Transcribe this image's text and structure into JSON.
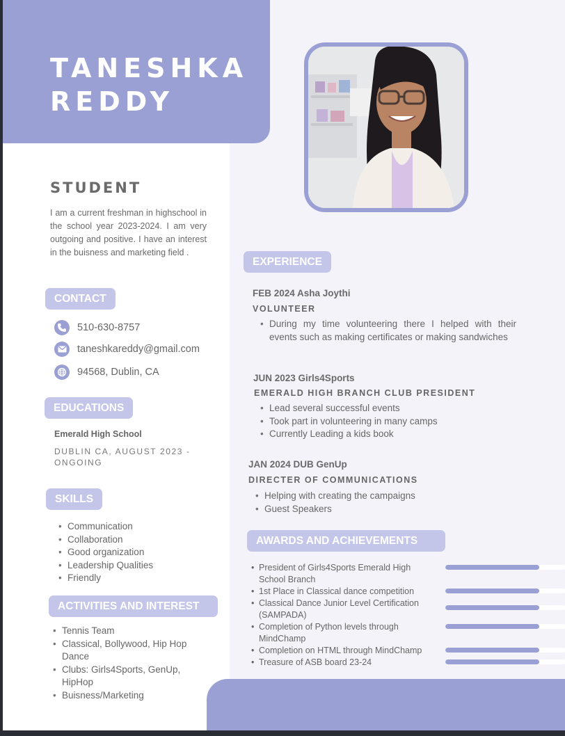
{
  "header": {
    "first_name": "TANESHKA",
    "last_name": "REDDY"
  },
  "profile": {
    "role": "STUDENT",
    "about": "I am a current freshman in highschool in the school year 2023-2024. I am very outgoing and positive. I have an interest in the buisness and marketing field ."
  },
  "contact": {
    "title": "CONTACT",
    "phone": "510-630-8757",
    "email": "taneshkareddy@gmail.com",
    "location": "94568, Dublin, CA"
  },
  "education": {
    "title": "EDUCATIONS",
    "school": "Emerald High School",
    "details": "DUBLIN CA, AUGUST 2023 - ONGOING"
  },
  "skills": {
    "title": "SKILLS",
    "items": [
      "Communication",
      "Collaboration",
      "Good organization",
      "Leadership Qualities",
      "Friendly"
    ]
  },
  "activities": {
    "title": "ACTIVITIES AND INTEREST",
    "items": [
      "Tennis Team",
      "Classical, Bollywood, Hip Hop Dance",
      "Clubs: Girls4Sports, GenUp, HipHop",
      "Buisness/Marketing"
    ]
  },
  "experience": {
    "title": "EXPERIENCE",
    "entries": [
      {
        "heading": "FEB 2024 Asha Joythi",
        "role": "VOLUNTEER",
        "points": [
          "During my time volunteering there I helped with their events such as making certificates or making sandwiches"
        ]
      },
      {
        "heading": "JUN 2023 Girls4Sports",
        "role": "EMERALD HIGH BRANCH CLUB PRESIDENT",
        "points": [
          "Lead several successful events",
          "Took part in volunteering in many camps",
          "Currently Leading a kids book"
        ]
      },
      {
        "heading": "JAN 2024 DUB GenUp",
        "role": "DIRECTER OF COMMUNICATIONS",
        "points": [
          "Helping with creating the campaigns",
          "Guest Speakers"
        ]
      }
    ]
  },
  "awards": {
    "title": "AWARDS AND  ACHIEVEMENTS",
    "items": [
      {
        "text": "President of Girls4Sports Emerald High School Branch",
        "level": 0.78
      },
      {
        "text": "1st Place in Classical dance competition",
        "level": 0.78
      },
      {
        "text": "Classical Dance Junior Level Certification (SAMPADA)",
        "level": 0.78
      },
      {
        "text": "Completion of Python levels through MindChamp",
        "level": 0.78
      },
      {
        "text": "Completion on HTML through MindChamp",
        "level": 0.78
      },
      {
        "text": "Treasure of ASB board 23-24",
        "level": 0.78
      }
    ]
  },
  "colors": {
    "accent": "#9aa0d4",
    "pill": "#c3c6e8",
    "panel": "#f4f3fa"
  },
  "icons": {
    "phone": "phone-icon",
    "email": "mail-icon",
    "location": "globe-icon"
  }
}
